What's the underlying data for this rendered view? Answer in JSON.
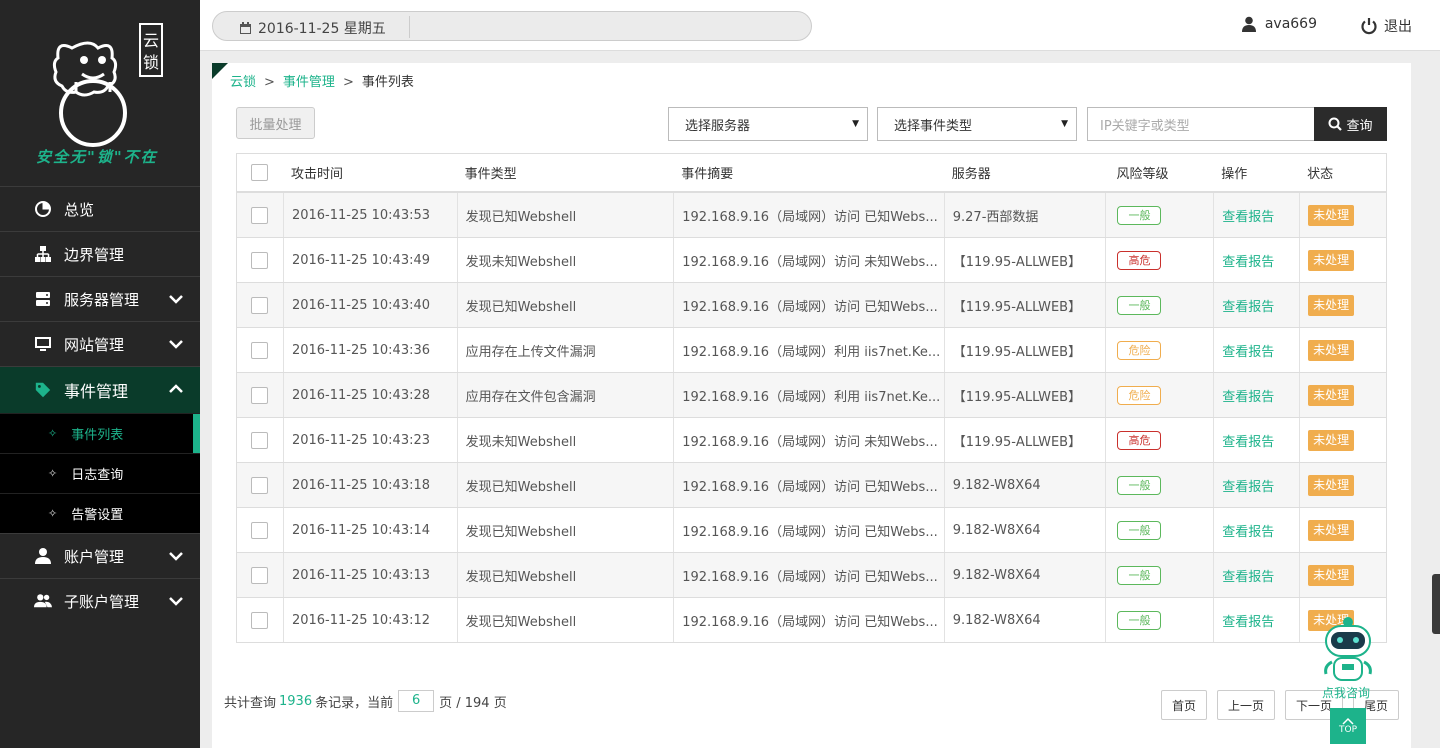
{
  "sidebar": {
    "slogan": "安全无\"锁\"不在",
    "logo_text": "云锁",
    "menu": [
      {
        "label": "总览",
        "icon": "pie-chart-icon"
      },
      {
        "label": "边界管理",
        "icon": "sitemap-icon"
      },
      {
        "label": "服务器管理",
        "icon": "server-icon"
      },
      {
        "label": "网站管理",
        "icon": "monitor-icon"
      },
      {
        "label": "事件管理",
        "icon": "tag-icon"
      },
      {
        "label": "账户管理",
        "icon": "user-icon"
      },
      {
        "label": "子账户管理",
        "icon": "users-icon"
      }
    ],
    "submenu": [
      {
        "label": "事件列表"
      },
      {
        "label": "日志查询"
      },
      {
        "label": "告警设置"
      }
    ]
  },
  "topbar": {
    "date": "2016-11-25 星期五",
    "username": "ava669",
    "logout": "退出"
  },
  "breadcrumb": [
    "云锁",
    "事件管理",
    "事件列表"
  ],
  "toolbar": {
    "batch_label": "批量处理",
    "server_select": "选择服务器",
    "type_select": "选择事件类型",
    "search_placeholder": "IP关键字或类型",
    "search_label": "查询"
  },
  "table": {
    "headers": [
      "攻击时间",
      "事件类型",
      "事件摘要",
      "服务器",
      "风险等级",
      "操作",
      "状态"
    ],
    "rows": [
      {
        "time": "2016-11-25 10:43:53",
        "type": "发现已知Webshell",
        "summary": "192.168.9.16（局域网）访问 已知Webs...",
        "server": "9.27-西部数据",
        "risk": "一般",
        "risk_level": "normal",
        "action": "查看报告",
        "status": "未处理"
      },
      {
        "time": "2016-11-25 10:43:49",
        "type": "发现未知Webshell",
        "summary": "192.168.9.16（局域网）访问 未知Webs...",
        "server": "【119.95-ALLWEB】",
        "risk": "高危",
        "risk_level": "high",
        "action": "查看报告",
        "status": "未处理"
      },
      {
        "time": "2016-11-25 10:43:40",
        "type": "发现已知Webshell",
        "summary": "192.168.9.16（局域网）访问 已知Webs...",
        "server": "【119.95-ALLWEB】",
        "risk": "一般",
        "risk_level": "normal",
        "action": "查看报告",
        "status": "未处理"
      },
      {
        "time": "2016-11-25 10:43:36",
        "type": "应用存在上传文件漏洞",
        "summary": "192.168.9.16（局域网）利用 iis7net.Ke...",
        "server": "【119.95-ALLWEB】",
        "risk": "危险",
        "risk_level": "danger",
        "action": "查看报告",
        "status": "未处理"
      },
      {
        "time": "2016-11-25 10:43:28",
        "type": "应用存在文件包含漏洞",
        "summary": "192.168.9.16（局域网）利用 iis7net.Ke...",
        "server": "【119.95-ALLWEB】",
        "risk": "危险",
        "risk_level": "danger",
        "action": "查看报告",
        "status": "未处理"
      },
      {
        "time": "2016-11-25 10:43:23",
        "type": "发现未知Webshell",
        "summary": "192.168.9.16（局域网）访问 未知Webs...",
        "server": "【119.95-ALLWEB】",
        "risk": "高危",
        "risk_level": "high",
        "action": "查看报告",
        "status": "未处理"
      },
      {
        "time": "2016-11-25 10:43:18",
        "type": "发现已知Webshell",
        "summary": "192.168.9.16（局域网）访问 已知Webs...",
        "server": "9.182-W8X64",
        "risk": "一般",
        "risk_level": "normal",
        "action": "查看报告",
        "status": "未处理"
      },
      {
        "time": "2016-11-25 10:43:14",
        "type": "发现已知Webshell",
        "summary": "192.168.9.16（局域网）访问 已知Webs...",
        "server": "9.182-W8X64",
        "risk": "一般",
        "risk_level": "normal",
        "action": "查看报告",
        "status": "未处理"
      },
      {
        "time": "2016-11-25 10:43:13",
        "type": "发现已知Webshell",
        "summary": "192.168.9.16（局域网）访问 已知Webs...",
        "server": "9.182-W8X64",
        "risk": "一般",
        "risk_level": "normal",
        "action": "查看报告",
        "status": "未处理"
      },
      {
        "time": "2016-11-25 10:43:12",
        "type": "发现已知Webshell",
        "summary": "192.168.9.16（局域网）访问 已知Webs...",
        "server": "9.182-W8X64",
        "risk": "一般",
        "risk_level": "normal",
        "action": "查看报告",
        "status": "未处理"
      }
    ]
  },
  "pagination": {
    "prefix": "共计查询",
    "total": "1936",
    "mid": "条记录，当前",
    "current_page": "6",
    "suffix": "页 / 194 页",
    "first": "首页",
    "prev": "上一页",
    "next": "下一页",
    "last": "尾页"
  },
  "helper": {
    "consult": "点我咨询",
    "top": "TOP"
  },
  "colors": {
    "accent": "#1db38b",
    "sidebar_bg": "#262626",
    "active_menu": "#0a3b2a",
    "status_orange": "#f0ad4e",
    "risk_high": "#c9302c",
    "risk_normal": "#5cb85c"
  }
}
